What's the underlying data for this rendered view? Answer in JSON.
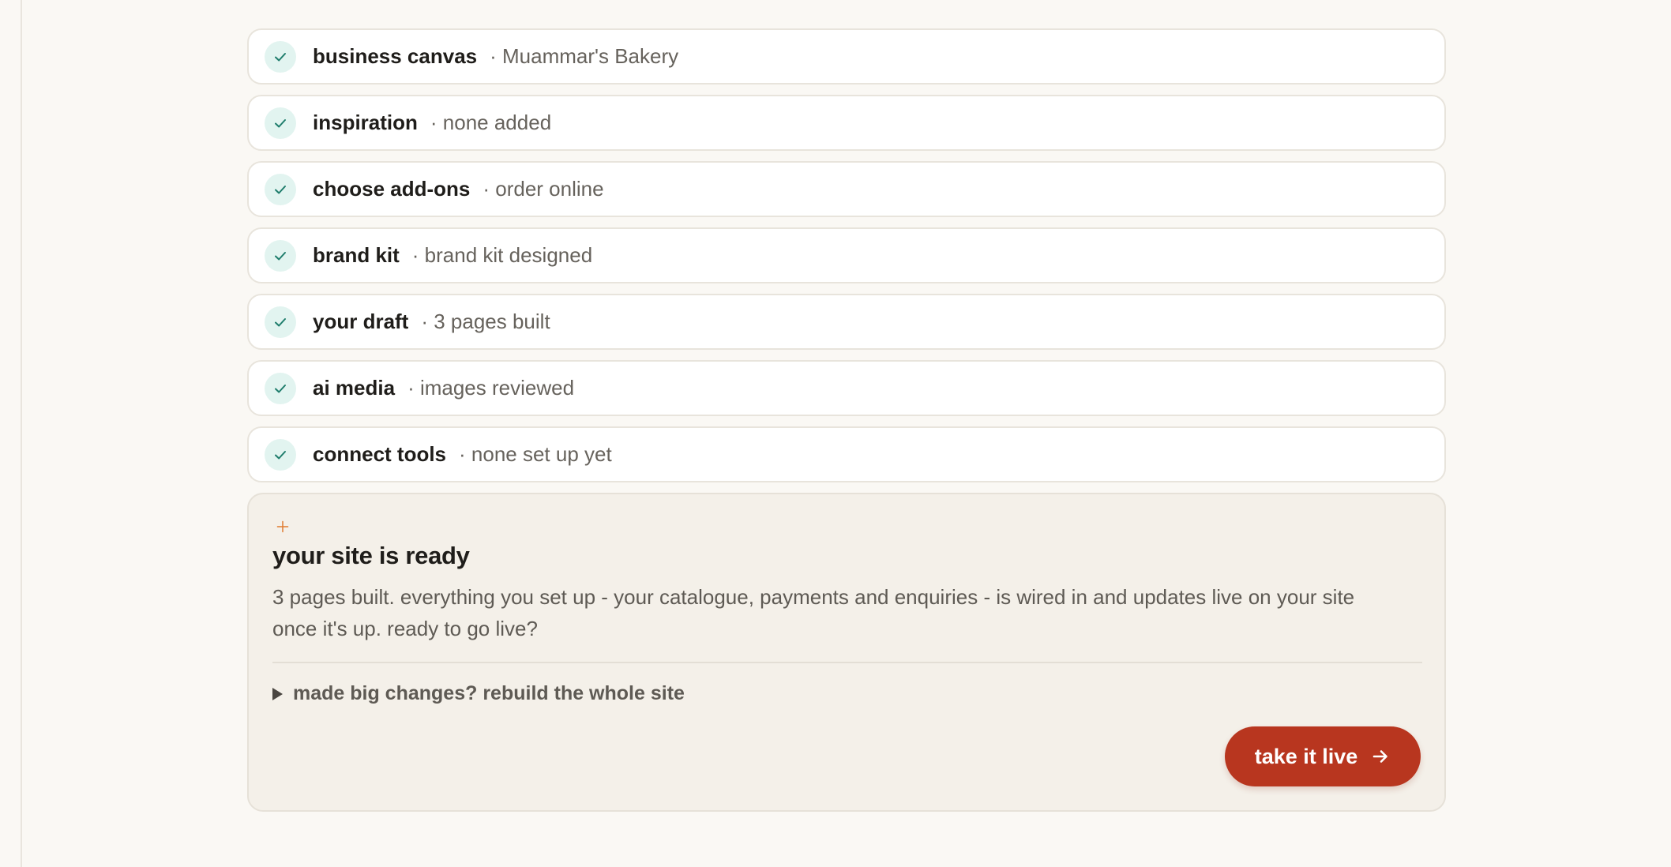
{
  "steps": [
    {
      "title": "business canvas",
      "detail": "· Muammar's Bakery"
    },
    {
      "title": "inspiration",
      "detail": "· none added"
    },
    {
      "title": "choose add-ons",
      "detail": "· order online"
    },
    {
      "title": "brand kit",
      "detail": "· brand kit designed"
    },
    {
      "title": "your draft",
      "detail": "· 3 pages built"
    },
    {
      "title": "ai media",
      "detail": "· images reviewed"
    },
    {
      "title": "connect tools",
      "detail": "· none set up yet"
    }
  ],
  "ready_card": {
    "title": "your site is ready",
    "body": "3 pages built. everything you set up - your catalogue, payments and enquiries - is wired in and updates live on your site once it's up. ready to go live?",
    "rebuild_label": "made big changes? rebuild the whole site",
    "cta_label": "take it live"
  },
  "colors": {
    "check_bg": "#e2f4f0",
    "check_mark": "#1f7d6c",
    "cta": "#b8361f",
    "sparkle": "#e07a2f"
  },
  "icons": {
    "step_status": "check-icon",
    "sparkle": "sparkle-icon",
    "toggle": "triangle-right-icon",
    "cta": "arrow-right-icon"
  }
}
